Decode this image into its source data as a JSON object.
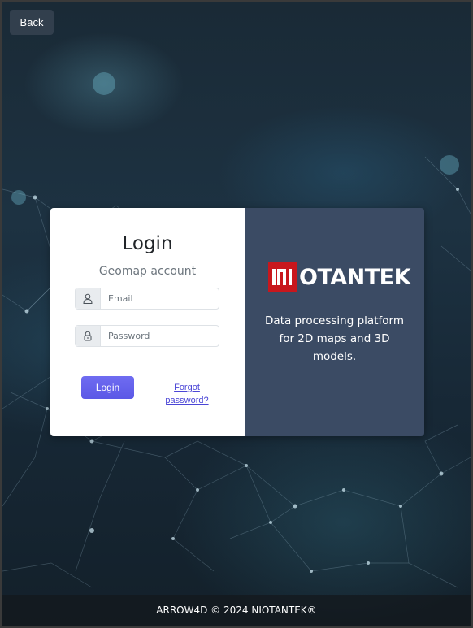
{
  "header": {
    "back_label": "Back"
  },
  "login_form": {
    "title": "Login",
    "subtitle": "Geomap account",
    "email_placeholder": "Email",
    "password_placeholder": "Password",
    "login_button": "Login",
    "forgot_link": "Forgot password?"
  },
  "brand_panel": {
    "logo_text": "OTANTEK",
    "logo_mark_text": "NI",
    "tagline": "Data processing platform for 2D maps and 3D models."
  },
  "footer": {
    "copyright": "ARROW4D © 2024 NIOTANTEK®"
  },
  "icons": {
    "email": "user-icon",
    "password": "lock-icon"
  },
  "colors": {
    "primary": "#5b58e6",
    "brand_red": "#c8171d",
    "panel_bg": "#3b4b64",
    "back_button_bg": "#323f4d"
  }
}
